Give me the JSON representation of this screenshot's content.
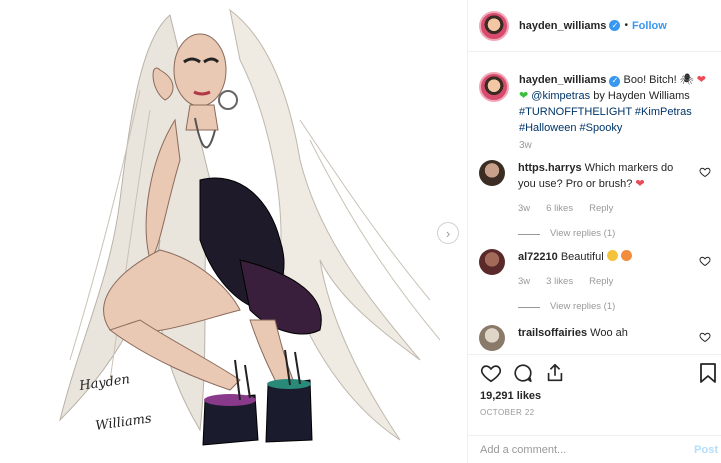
{
  "post": {
    "author": {
      "username": "hayden_williams",
      "verified_icon": "verified-badge-icon",
      "follow_separator": "•",
      "follow_label": "Follow"
    },
    "caption": {
      "username": "hayden_williams",
      "text_1": "Boo! Bitch! 🕷",
      "mention": "@kimpetras",
      "text_2": "by Hayden Williams",
      "hashtags": [
        "#TURNOFFTHELIGHT",
        "#KimPetras",
        "#Halloween",
        "#Spooky"
      ],
      "time": "3w"
    },
    "artwork": {
      "signature_text": "Hayden Williams"
    },
    "comments": [
      {
        "username": "https.harrys",
        "text": "Which markers do you use? Pro or brush?",
        "emoji": "red-heart-icon",
        "time": "3w",
        "likes": "6 likes",
        "reply_label": "Reply",
        "view_replies": "View replies (1)"
      },
      {
        "username": "al72210",
        "text": "Beautiful",
        "emoji": "smiling-face-icon",
        "time": "3w",
        "likes": "3 likes",
        "reply_label": "Reply",
        "view_replies": "View replies (1)"
      },
      {
        "username": "trailsoffairies",
        "text": "Woo ah"
      }
    ],
    "likes": "19,291 likes",
    "date": "OCTOBER 22",
    "add_comment": {
      "placeholder": "Add a comment...",
      "post_label": "Post"
    },
    "colors": {
      "accent": "#3897f0",
      "link": "#003569",
      "muted": "#999999",
      "heart": "#ed4956"
    }
  }
}
